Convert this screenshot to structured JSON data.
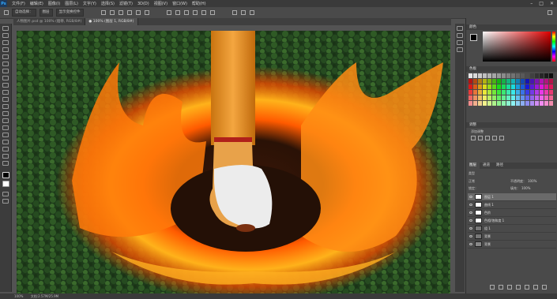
{
  "app": {
    "logo": "Ps"
  },
  "menu": [
    "文件(F)",
    "编辑(E)",
    "图像(I)",
    "图层(L)",
    "文字(Y)",
    "选择(S)",
    "滤镜(T)",
    "3D(D)",
    "视图(V)",
    "窗口(W)",
    "帮助(H)"
  ],
  "options": {
    "auto_select": "自动选择：",
    "target": "图层",
    "transform": "显示变换控件"
  },
  "tabs": [
    "人物图片.psd @ 100% (烟蒂, RGB/8#)",
    "● 100% (图层 1, RGB/8#)"
  ],
  "panels": {
    "color": "颜色",
    "swatches": "色板",
    "adjustments": "调整",
    "add_adjustment": "添加调整",
    "layers": "图层",
    "channels": "通道",
    "paths": "路径"
  },
  "layers_panel": {
    "kind": "类型",
    "mode": "正常",
    "opacity_label": "不透明度：",
    "opacity": "100%",
    "lock_label": "锁定：",
    "fill_label": "填充：",
    "fill": "100%"
  },
  "layers": [
    {
      "name": "图层 1",
      "selected": true
    },
    {
      "name": "曲线 1",
      "selected": false
    },
    {
      "name": "色阶",
      "selected": false
    },
    {
      "name": "色相/饱和度 1",
      "selected": false
    },
    {
      "name": "组 1",
      "selected": false
    },
    {
      "name": "背景",
      "selected": false
    },
    {
      "name": "背景",
      "selected": false
    }
  ],
  "status": {
    "zoom": "100%",
    "doc": "文档:2.57M/25.9M"
  }
}
